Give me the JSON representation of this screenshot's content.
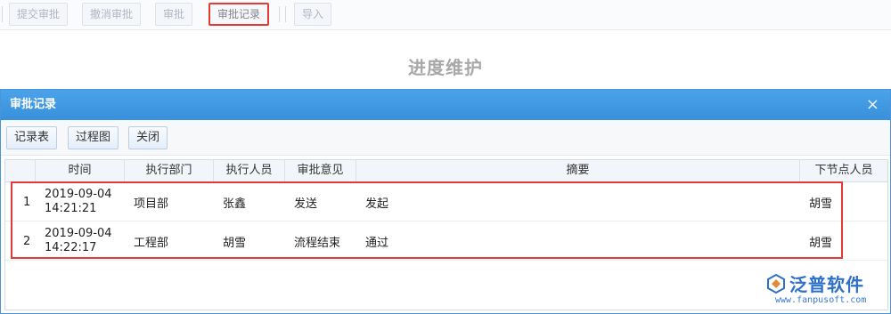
{
  "toolbar": {
    "buttons": [
      "提交审批",
      "撤消审批",
      "审批",
      "审批记录",
      "导入"
    ]
  },
  "page": {
    "title": "进度维护"
  },
  "dialog": {
    "title": "审批记录",
    "close_icon": "×",
    "buttons": [
      "记录表",
      "过程图",
      "关闭"
    ]
  },
  "grid": {
    "headers": [
      "时间",
      "执行部门",
      "执行人员",
      "审批意见",
      "摘要",
      "下节点人员"
    ],
    "rows": [
      {
        "no": "1",
        "date": "2019-09-04",
        "time": "14:21:21",
        "dept": "项目部",
        "person": "张鑫",
        "opinion": "发送",
        "summary": "发起",
        "next": "胡雪"
      },
      {
        "no": "2",
        "date": "2019-09-04",
        "time": "14:22:17",
        "dept": "工程部",
        "person": "胡雪",
        "opinion": "流程结束",
        "summary": "通过",
        "next": "胡雪"
      }
    ]
  },
  "logo": {
    "name": "泛普软件",
    "url": "www.fanpusoft.com"
  },
  "colors": {
    "dialog_header": "#3990db",
    "highlight": "#e23a3a",
    "logo": "#2e6fc8"
  }
}
